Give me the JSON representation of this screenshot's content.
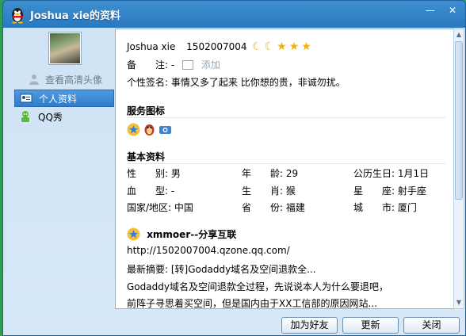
{
  "window": {
    "title": "Joshua xie的资料",
    "minimize_glyph": "—",
    "close_glyph": "✕"
  },
  "sidebar": {
    "hd_avatar_label": "查看高清头像",
    "items": [
      {
        "label": "个人资料",
        "icon": "profile-card-icon",
        "active": true
      },
      {
        "label": "QQ秀",
        "icon": "qqshow-icon",
        "active": false
      }
    ]
  },
  "profile": {
    "nickname": "Joshua xie",
    "qq_number": "1502007004",
    "level_icons": [
      "moon",
      "moon",
      "star",
      "star",
      "star"
    ],
    "remark_label": "备　　注: -",
    "remark_add": "添加",
    "signature_label": "个性签名:",
    "signature": "事情又多了起来  比你想的贵，非诚勿扰。"
  },
  "sections": {
    "service_icons_title": "服务图标",
    "basic_info_title": "基本资料",
    "space_title": "xmmoer--分享互联"
  },
  "basic_info": {
    "gender_label": "性　　别:",
    "gender": "男",
    "age_label": "年　　龄:",
    "age": "29",
    "birthday_label": "公历生日:",
    "birthday": "1月1日",
    "blood_label": "血　　型:",
    "blood": "-",
    "zodiac_label": "生　　肖:",
    "zodiac": "猴",
    "star_label": "星　　座:",
    "star": "射手座",
    "country_label": "国家/地区:",
    "country": "中国",
    "province_label": "省　　份:",
    "province": "福建",
    "city_label": "城　　市:",
    "city": "厦门"
  },
  "space": {
    "url": "http://1502007004.qzone.qq.com/",
    "latest": "最新摘要: [转]Godaddy域名及空间退款全...",
    "line2": "Godaddy域名及空间退款全过程，先说说本人为什么要退吧，",
    "line3": "前阵子寻思着买空间，但是国内由于XX工信部的原因网站..."
  },
  "buttons": {
    "add_friend": "加为好友",
    "refresh": "更新",
    "close": "关闭"
  },
  "colors": {
    "titlebar": "#2a79c0",
    "accent": "#2f7ccc",
    "desktop": "#2f9c57"
  }
}
